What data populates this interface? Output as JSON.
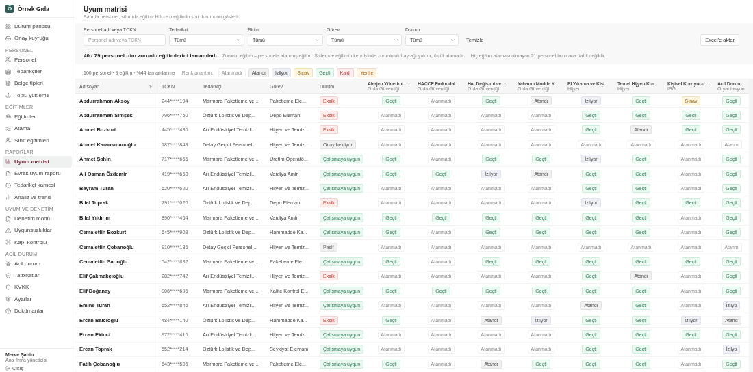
{
  "brand": {
    "logo_letter": "Ö",
    "name": "Örnek Gıda"
  },
  "sidebar": {
    "sections": [
      {
        "items": [
          {
            "label": "Durum panosu",
            "selected": false
          },
          {
            "label": "Onay kuyruğu",
            "selected": false
          }
        ]
      },
      {
        "title": "PERSONEL",
        "items": [
          {
            "label": "Personel",
            "selected": false
          },
          {
            "label": "Tedarikçiler",
            "selected": false
          },
          {
            "label": "Belge tipleri",
            "selected": false
          },
          {
            "label": "Toplu yükleme",
            "selected": false
          }
        ]
      },
      {
        "title": "EĞİTİMLER",
        "items": [
          {
            "label": "Eğitimler",
            "selected": false
          },
          {
            "label": "Atama",
            "selected": false
          },
          {
            "label": "Sınıf eğitimleri",
            "selected": false
          }
        ]
      },
      {
        "title": "RAPORLAR",
        "items": [
          {
            "label": "Uyum matrisi",
            "selected": true
          },
          {
            "label": "Evrak uyum raporu",
            "selected": false
          },
          {
            "label": "Tedarikçi karnesi",
            "selected": false
          },
          {
            "label": "Analiz ve trend",
            "selected": false
          }
        ]
      },
      {
        "title": "UYUM VE DENETİM",
        "items": [
          {
            "label": "Denetim modu",
            "selected": false
          },
          {
            "label": "Uygunsuzluklar",
            "selected": false
          },
          {
            "label": "Kapı kontrolü",
            "selected": false
          }
        ]
      },
      {
        "title": "ACİL DURUM",
        "items": [
          {
            "label": "Acil durum",
            "selected": false
          },
          {
            "label": "Tatbikatlar",
            "selected": false
          },
          {
            "label": "KVKK",
            "selected": false
          },
          {
            "label": "Ayarlar",
            "selected": false
          },
          {
            "label": "Dokümanlar",
            "selected": false
          }
        ]
      }
    ]
  },
  "user": {
    "name": "Merve Şahin",
    "role": "Ana firma yöneticisi",
    "logout": "Çıkış"
  },
  "page": {
    "title": "Uyum matrisi",
    "subtitle": "Satırda personel, sütunda eğitim. Hücre o eğitimin son durumunu gösterir."
  },
  "filters": {
    "search": {
      "label": "Personel adı veya TCKN",
      "placeholder": "Personel adı veya TCKN"
    },
    "selects": [
      {
        "label": "Tedarikçi",
        "value": "Tümü"
      },
      {
        "label": "Birim",
        "value": "Tümü"
      },
      {
        "label": "Görev",
        "value": "Tümü"
      },
      {
        "label": "Durum",
        "value": "Tümü"
      }
    ],
    "clear": "Temizle",
    "export": "Excel'e aktar"
  },
  "summary": {
    "headline": "40 / 79 personel tüm zorunlu eğitimlerini tamamladı",
    "note": "Zorunlu eğitim = personele atanmış eğitim. Sistemde eğitimin kendisinde zorunluluk bayrağı yoktur; ölçüt atamadır.",
    "excluded": "Hiç eğitim ataması olmayan 21 personel bu orana dahil değildir."
  },
  "legend": {
    "stats": "100 personel · 9 eğitim · %44 tamamlanma",
    "title": "Renk anahtarı:",
    "items": [
      {
        "text": "Atanmadı",
        "kind": "unassigned"
      },
      {
        "text": "Atandı",
        "kind": "assigned"
      },
      {
        "text": "İzliyor",
        "kind": "watching"
      },
      {
        "text": "Sınav",
        "kind": "exam"
      },
      {
        "text": "Geçti",
        "kind": "passed"
      },
      {
        "text": "Kaldı",
        "kind": "failed"
      },
      {
        "text": "Yenile",
        "kind": "renew"
      }
    ]
  },
  "table": {
    "columns": [
      "Ad soyad",
      "TCKN",
      "Tedarikçi",
      "Görev",
      "Durum"
    ],
    "trainings": [
      {
        "name": "Alerjen Yönetimi ...",
        "category": "Gıda Güvenliği"
      },
      {
        "name": "HACCP Farkındal...",
        "category": "Gıda Güvenliği"
      },
      {
        "name": "Hat Değişimi ve ...",
        "category": "Gıda Güvenliği"
      },
      {
        "name": "Yabancı Madde K...",
        "category": "Gıda Güvenliği"
      },
      {
        "name": "El Yıkama ve Kişi...",
        "category": "Hijyen"
      },
      {
        "name": "Temel Hijyen Kur...",
        "category": "Hijyen"
      },
      {
        "name": "Kişisel Koruyucu ...",
        "category": "İSG"
      },
      {
        "name": "Acil Durum",
        "category": "Oryantasyon"
      }
    ],
    "rows": [
      {
        "name": "Abdurrahman Aksoy",
        "tckn": "244*****194",
        "supplier": "Marmara Paketleme ve...",
        "role": "Paketleme Ele...",
        "status": {
          "text": "Eksik",
          "kind": "missing"
        },
        "cells": [
          {
            "text": "Geçti",
            "kind": "passed"
          },
          {
            "text": "Atanmadı",
            "kind": "unassigned"
          },
          {
            "text": "Geçti",
            "kind": "passed"
          },
          {
            "text": "Atandı",
            "kind": "assigned"
          },
          {
            "text": "İzliyor",
            "kind": "watching"
          },
          {
            "text": "Geçti",
            "kind": "passed"
          },
          {
            "text": "Sınav",
            "kind": "exam"
          },
          {
            "text": "Geçti",
            "kind": "passed"
          }
        ]
      },
      {
        "name": "Abdurrahman Şimşek",
        "tckn": "796*****750",
        "supplier": "Öztürk Lojistik ve Dep...",
        "role": "Depo Elemanı",
        "status": {
          "text": "Eksik",
          "kind": "missing"
        },
        "cells": [
          {
            "text": "Atanmadı",
            "kind": "unassigned"
          },
          {
            "text": "Atanmadı",
            "kind": "unassigned"
          },
          {
            "text": "Atanmadı",
            "kind": "unassigned"
          },
          {
            "text": "Atanmadı",
            "kind": "unassigned"
          },
          {
            "text": "Geçti",
            "kind": "passed"
          },
          {
            "text": "Geçti",
            "kind": "passed"
          },
          {
            "text": "Geçti",
            "kind": "passed"
          },
          {
            "text": "Geçti",
            "kind": "passed"
          }
        ]
      },
      {
        "name": "Ahmet Bozkurt",
        "tckn": "445*****436",
        "supplier": "Arı Endüstriyel Temizli...",
        "role": "Hijyen ve Temiz...",
        "status": {
          "text": "Eksik",
          "kind": "missing"
        },
        "cells": [
          {
            "text": "Atanmadı",
            "kind": "unassigned"
          },
          {
            "text": "Atanmadı",
            "kind": "unassigned"
          },
          {
            "text": "Atanmadı",
            "kind": "unassigned"
          },
          {
            "text": "Atanmadı",
            "kind": "unassigned"
          },
          {
            "text": "Geçti",
            "kind": "passed"
          },
          {
            "text": "Atandı",
            "kind": "assigned"
          },
          {
            "text": "Geçti",
            "kind": "passed"
          },
          {
            "text": "Geçti",
            "kind": "passed"
          }
        ]
      },
      {
        "name": "Ahmet Karaosmanoğlu",
        "tckn": "187*****848",
        "supplier": "Detay Geçici Personel ...",
        "role": "Hijyen ve Temiz...",
        "status": {
          "text": "Onay bekliyor",
          "kind": "pending"
        },
        "cells": [
          {
            "text": "Atanmadı",
            "kind": "unassigned"
          },
          {
            "text": "Atanmadı",
            "kind": "unassigned"
          },
          {
            "text": "Atanmadı",
            "kind": "unassigned"
          },
          {
            "text": "Atanmadı",
            "kind": "unassigned"
          },
          {
            "text": "Atanmadı",
            "kind": "unassigned"
          },
          {
            "text": "Atanmadı",
            "kind": "unassigned"
          },
          {
            "text": "Atanmadı",
            "kind": "unassigned"
          },
          {
            "text": "Atanm",
            "kind": "unassigned"
          }
        ]
      },
      {
        "name": "Ahmet Şahin",
        "tckn": "717*****666",
        "supplier": "Marmara Paketleme ve...",
        "role": "Üretim Operatö...",
        "status": {
          "text": "Çalışmaya uygun",
          "kind": "fit"
        },
        "cells": [
          {
            "text": "Geçti",
            "kind": "passed"
          },
          {
            "text": "Atanmadı",
            "kind": "unassigned"
          },
          {
            "text": "Geçti",
            "kind": "passed"
          },
          {
            "text": "Geçti",
            "kind": "passed"
          },
          {
            "text": "İzliyor",
            "kind": "watching"
          },
          {
            "text": "Geçti",
            "kind": "passed"
          },
          {
            "text": "Atanmadı",
            "kind": "unassigned"
          },
          {
            "text": "Geçti",
            "kind": "passed"
          }
        ]
      },
      {
        "name": "Ali Osman Özdemir",
        "tckn": "419*****668",
        "supplier": "Arı Endüstriyel Temizli...",
        "role": "Vardiya Amiri",
        "status": {
          "text": "Çalışmaya uygun",
          "kind": "fit"
        },
        "cells": [
          {
            "text": "Geçti",
            "kind": "passed"
          },
          {
            "text": "Geçti",
            "kind": "passed"
          },
          {
            "text": "İzliyor",
            "kind": "watching"
          },
          {
            "text": "Atandı",
            "kind": "assigned"
          },
          {
            "text": "Geçti",
            "kind": "passed"
          },
          {
            "text": "Geçti",
            "kind": "passed"
          },
          {
            "text": "Atanmadı",
            "kind": "unassigned"
          },
          {
            "text": "Geçti",
            "kind": "passed"
          }
        ]
      },
      {
        "name": "Bayram Turan",
        "tckn": "620*****620",
        "supplier": "Arı Endüstriyel Temizli...",
        "role": "Hijyen ve Temiz...",
        "status": {
          "text": "Çalışmaya uygun",
          "kind": "fit"
        },
        "cells": [
          {
            "text": "Atanmadı",
            "kind": "unassigned"
          },
          {
            "text": "Atanmadı",
            "kind": "unassigned"
          },
          {
            "text": "Atanmadı",
            "kind": "unassigned"
          },
          {
            "text": "Atanmadı",
            "kind": "unassigned"
          },
          {
            "text": "Geçti",
            "kind": "passed"
          },
          {
            "text": "Geçti",
            "kind": "passed"
          },
          {
            "text": "Atanmadı",
            "kind": "unassigned"
          },
          {
            "text": "Geçti",
            "kind": "passed"
          }
        ]
      },
      {
        "name": "Bilal Toprak",
        "tckn": "791*****020",
        "supplier": "Öztürk Lojistik ve Dep...",
        "role": "Depo Elemanı",
        "status": {
          "text": "Eksik",
          "kind": "missing"
        },
        "cells": [
          {
            "text": "Atanmadı",
            "kind": "unassigned"
          },
          {
            "text": "Atanmadı",
            "kind": "unassigned"
          },
          {
            "text": "Atanmadı",
            "kind": "unassigned"
          },
          {
            "text": "Atanmadı",
            "kind": "unassigned"
          },
          {
            "text": "İzliyor",
            "kind": "watching"
          },
          {
            "text": "Geçti",
            "kind": "passed"
          },
          {
            "text": "Geçti",
            "kind": "passed"
          },
          {
            "text": "Geçti",
            "kind": "passed"
          }
        ]
      },
      {
        "name": "Bilal Yıldırım",
        "tckn": "890*****464",
        "supplier": "Marmara Paketleme ve...",
        "role": "Vardiya Amiri",
        "status": {
          "text": "Çalışmaya uygun",
          "kind": "fit"
        },
        "cells": [
          {
            "text": "Geçti",
            "kind": "passed"
          },
          {
            "text": "Geçti",
            "kind": "passed"
          },
          {
            "text": "Geçti",
            "kind": "passed"
          },
          {
            "text": "Geçti",
            "kind": "passed"
          },
          {
            "text": "Geçti",
            "kind": "passed"
          },
          {
            "text": "Geçti",
            "kind": "passed"
          },
          {
            "text": "Atanmadı",
            "kind": "unassigned"
          },
          {
            "text": "Geçti",
            "kind": "passed"
          }
        ]
      },
      {
        "name": "Cemalettin Bozkurt",
        "tckn": "645*****908",
        "supplier": "Öztürk Lojistik ve Dep...",
        "role": "Hammadde Ka...",
        "status": {
          "text": "Çalışmaya uygun",
          "kind": "fit"
        },
        "cells": [
          {
            "text": "Geçti",
            "kind": "passed"
          },
          {
            "text": "Atanmadı",
            "kind": "unassigned"
          },
          {
            "text": "Geçti",
            "kind": "passed"
          },
          {
            "text": "Geçti",
            "kind": "passed"
          },
          {
            "text": "Geçti",
            "kind": "passed"
          },
          {
            "text": "Geçti",
            "kind": "passed"
          },
          {
            "text": "Atanmadı",
            "kind": "unassigned"
          },
          {
            "text": "Geçti",
            "kind": "passed"
          }
        ]
      },
      {
        "name": "Cemalettin Çobanoğlu",
        "tckn": "910*****186",
        "supplier": "Detay Geçici Personel ...",
        "role": "Hijyen ve Temiz...",
        "status": {
          "text": "Pasif",
          "kind": "passive"
        },
        "cells": [
          {
            "text": "Atanmadı",
            "kind": "unassigned"
          },
          {
            "text": "Atanmadı",
            "kind": "unassigned"
          },
          {
            "text": "Atanmadı",
            "kind": "unassigned"
          },
          {
            "text": "Atanmadı",
            "kind": "unassigned"
          },
          {
            "text": "Atanmadı",
            "kind": "unassigned"
          },
          {
            "text": "Atanmadı",
            "kind": "unassigned"
          },
          {
            "text": "Atanmadı",
            "kind": "unassigned"
          },
          {
            "text": "Atanm",
            "kind": "unassigned"
          }
        ]
      },
      {
        "name": "Cemalettin Sarıoğlu",
        "tckn": "542*****832",
        "supplier": "Marmara Paketleme ve...",
        "role": "Paketleme Ele...",
        "status": {
          "text": "Çalışmaya uygun",
          "kind": "fit"
        },
        "cells": [
          {
            "text": "Geçti",
            "kind": "passed"
          },
          {
            "text": "Atanmadı",
            "kind": "unassigned"
          },
          {
            "text": "Geçti",
            "kind": "passed"
          },
          {
            "text": "Geçti",
            "kind": "passed"
          },
          {
            "text": "Geçti",
            "kind": "passed"
          },
          {
            "text": "Geçti",
            "kind": "passed"
          },
          {
            "text": "Geçti",
            "kind": "passed"
          },
          {
            "text": "Geçti",
            "kind": "passed"
          }
        ]
      },
      {
        "name": "Elif Çakmakçıoğlu",
        "tckn": "282*****742",
        "supplier": "Arı Endüstriyel Temizli...",
        "role": "Hijyen ve Temiz...",
        "status": {
          "text": "Eksik",
          "kind": "missing"
        },
        "cells": [
          {
            "text": "Atanmadı",
            "kind": "unassigned"
          },
          {
            "text": "Atanmadı",
            "kind": "unassigned"
          },
          {
            "text": "Atanmadı",
            "kind": "unassigned"
          },
          {
            "text": "Atanmadı",
            "kind": "unassigned"
          },
          {
            "text": "Geçti",
            "kind": "passed"
          },
          {
            "text": "Atandı",
            "kind": "assigned"
          },
          {
            "text": "Atanmadı",
            "kind": "unassigned"
          },
          {
            "text": "Geçti",
            "kind": "passed"
          }
        ]
      },
      {
        "name": "Elif Doğanay",
        "tckn": "906*****696",
        "supplier": "Marmara Paketleme ve...",
        "role": "Kalite Kontrol E...",
        "status": {
          "text": "Çalışmaya uygun",
          "kind": "fit"
        },
        "cells": [
          {
            "text": "Geçti",
            "kind": "passed"
          },
          {
            "text": "Geçti",
            "kind": "passed"
          },
          {
            "text": "Geçti",
            "kind": "passed"
          },
          {
            "text": "Geçti",
            "kind": "passed"
          },
          {
            "text": "Geçti",
            "kind": "passed"
          },
          {
            "text": "Geçti",
            "kind": "passed"
          },
          {
            "text": "Atanmadı",
            "kind": "unassigned"
          },
          {
            "text": "Geçti",
            "kind": "passed"
          }
        ]
      },
      {
        "name": "Emine Turan",
        "tckn": "652*****846",
        "supplier": "Arı Endüstriyel Temizli...",
        "role": "Hijyen ve Temiz...",
        "status": {
          "text": "Çalışmaya uygun",
          "kind": "fit"
        },
        "cells": [
          {
            "text": "Atanmadı",
            "kind": "unassigned"
          },
          {
            "text": "Atanmadı",
            "kind": "unassigned"
          },
          {
            "text": "Atanmadı",
            "kind": "unassigned"
          },
          {
            "text": "Atanmadı",
            "kind": "unassigned"
          },
          {
            "text": "Atandı",
            "kind": "assigned"
          },
          {
            "text": "Geçti",
            "kind": "passed"
          },
          {
            "text": "Atanmadı",
            "kind": "unassigned"
          },
          {
            "text": "İzliyo",
            "kind": "watching"
          }
        ]
      },
      {
        "name": "Ercan Balcıoğlu",
        "tckn": "484*****140",
        "supplier": "Öztürk Lojistik ve Dep...",
        "role": "Hammadde Ka...",
        "status": {
          "text": "Eksik",
          "kind": "missing"
        },
        "cells": [
          {
            "text": "Geçti",
            "kind": "passed"
          },
          {
            "text": "Atanmadı",
            "kind": "unassigned"
          },
          {
            "text": "Atandı",
            "kind": "assigned"
          },
          {
            "text": "İzliyor",
            "kind": "watching"
          },
          {
            "text": "Geçti",
            "kind": "passed"
          },
          {
            "text": "Geçti",
            "kind": "passed"
          },
          {
            "text": "İzliyor",
            "kind": "watching"
          },
          {
            "text": "Atand",
            "kind": "assigned"
          }
        ]
      },
      {
        "name": "Ercan Ekinci",
        "tckn": "972*****416",
        "supplier": "Arı Endüstriyel Temizli...",
        "role": "Hijyen ve Temiz...",
        "status": {
          "text": "Çalışmaya uygun",
          "kind": "fit"
        },
        "cells": [
          {
            "text": "Atanmadı",
            "kind": "unassigned"
          },
          {
            "text": "Atanmadı",
            "kind": "unassigned"
          },
          {
            "text": "Atanmadı",
            "kind": "unassigned"
          },
          {
            "text": "Atanmadı",
            "kind": "unassigned"
          },
          {
            "text": "Geçti",
            "kind": "passed"
          },
          {
            "text": "Geçti",
            "kind": "passed"
          },
          {
            "text": "Geçti",
            "kind": "passed"
          },
          {
            "text": "Geçti",
            "kind": "passed"
          }
        ]
      },
      {
        "name": "Ercan Toprak",
        "tckn": "552*****214",
        "supplier": "Öztürk Lojistik ve Dep...",
        "role": "Sevkiyat Elemanı",
        "status": {
          "text": "Çalışmaya uygun",
          "kind": "fit"
        },
        "cells": [
          {
            "text": "Atanmadı",
            "kind": "unassigned"
          },
          {
            "text": "Atanmadı",
            "kind": "unassigned"
          },
          {
            "text": "Atanmadı",
            "kind": "unassigned"
          },
          {
            "text": "Atanmadı",
            "kind": "unassigned"
          },
          {
            "text": "Geçti",
            "kind": "passed"
          },
          {
            "text": "Geçti",
            "kind": "passed"
          },
          {
            "text": "Atanmadı",
            "kind": "unassigned"
          },
          {
            "text": "İzliyo",
            "kind": "watching"
          }
        ]
      },
      {
        "name": "Fatih Çobanoğlu",
        "tckn": "643*****506",
        "supplier": "Marmara Paketleme ve...",
        "role": "Paketleme Ele...",
        "status": {
          "text": "Çalışmaya uygun",
          "kind": "fit"
        },
        "cells": [
          {
            "text": "Geçti",
            "kind": "passed"
          },
          {
            "text": "Atanmadı",
            "kind": "unassigned"
          },
          {
            "text": "Atandı",
            "kind": "assigned"
          },
          {
            "text": "Geçti",
            "kind": "passed"
          },
          {
            "text": "Geçti",
            "kind": "passed"
          },
          {
            "text": "Geçti",
            "kind": "passed"
          },
          {
            "text": "Atanmadı",
            "kind": "unassigned"
          },
          {
            "text": "Geçti",
            "kind": "passed"
          }
        ]
      }
    ]
  }
}
